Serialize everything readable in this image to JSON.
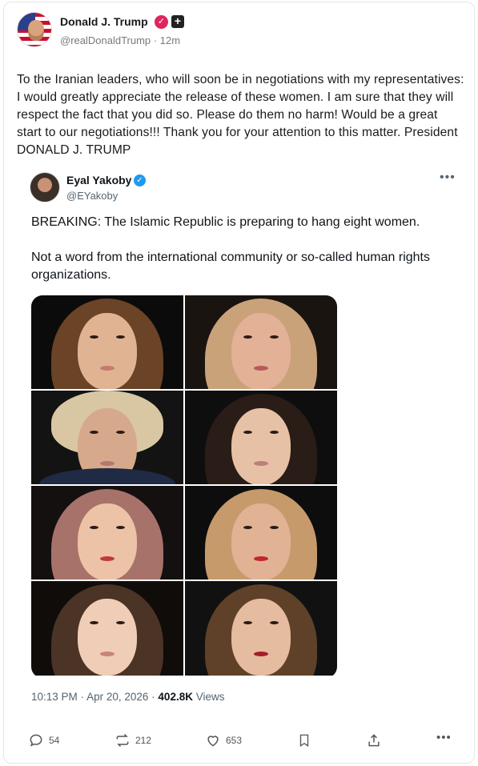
{
  "post": {
    "author": {
      "name": "Donald J. Trump",
      "handle": "@realDonaldTrump",
      "time": "12m",
      "separator": "·"
    },
    "body": "To the Iranian leaders, who will soon be in negotiations with my representatives: I would greatly appreciate the release of these women. I am sure that they will respect the fact that you did so. Please do them no harm! Would be a great start to our negotiations!!! Thank you for your attention to this matter. President DONALD J. TRUMP"
  },
  "quote": {
    "author": {
      "name": "Eyal Yakoby",
      "handle": "@EYakoby"
    },
    "paragraphs": [
      "BREAKING: The Islamic Republic is preparing to hang eight women.",
      "Not a word from the international community or so-called human rights organizations."
    ],
    "meta": {
      "time": "10:13 PM",
      "date": "Apr 20, 2026",
      "views_count": "402.8K",
      "views_label": "Views",
      "separator": "·"
    }
  },
  "actions": {
    "replies": "54",
    "reposts": "212",
    "likes": "653"
  },
  "colors": {
    "verified_red": "#e0245e",
    "verified_blue": "#1d9bf0",
    "text_primary": "#0f1419",
    "text_secondary": "#536471"
  },
  "icons": [
    "verified-badge-icon",
    "plus-badge-icon",
    "more-icon",
    "reply-icon",
    "repost-icon",
    "like-icon",
    "bookmark-icon",
    "share-icon"
  ]
}
